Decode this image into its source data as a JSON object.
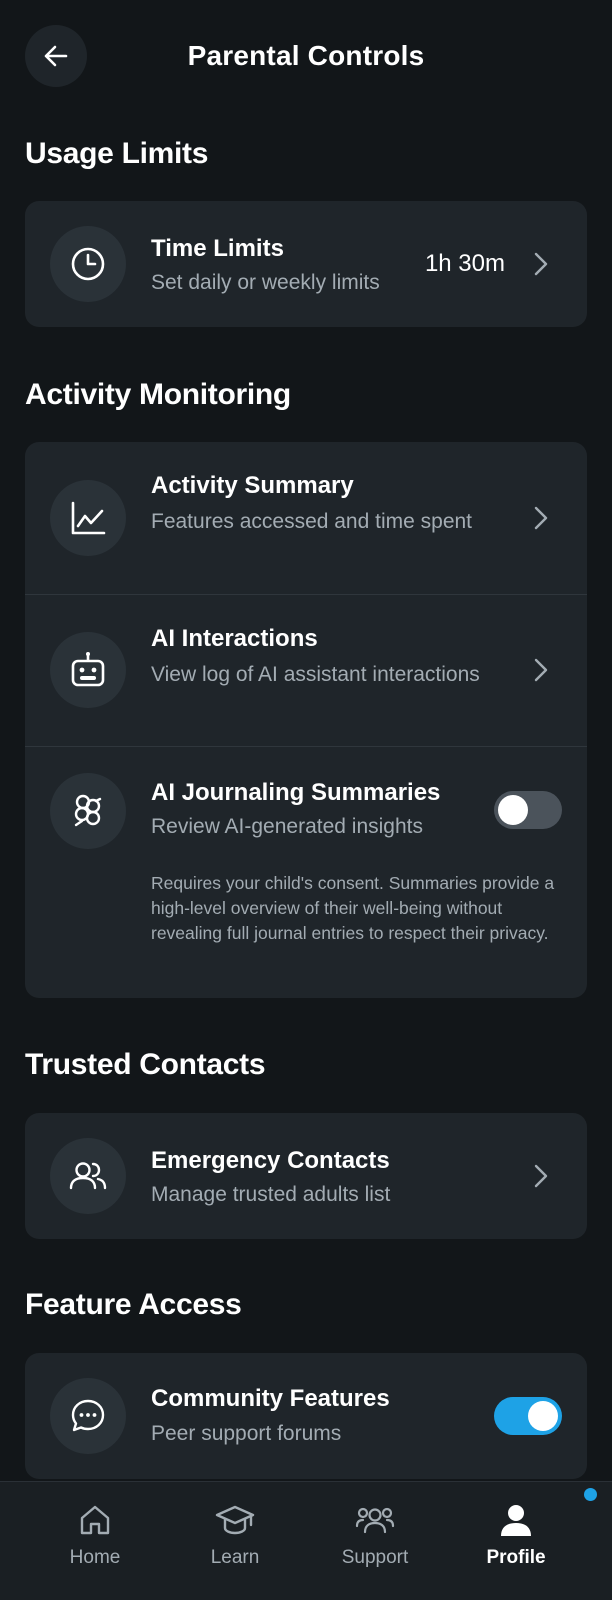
{
  "header": {
    "title": "Parental Controls"
  },
  "sections": {
    "usage": {
      "title": "Usage Limits",
      "time_limits": {
        "title": "Time Limits",
        "subtitle": "Set daily or weekly limits",
        "value": "1h 30m"
      }
    },
    "activity": {
      "title": "Activity Monitoring",
      "summary": {
        "title": "Activity Summary",
        "subtitle": "Features accessed and time spent"
      },
      "ai_interactions": {
        "title": "AI Interactions",
        "subtitle": "View log of AI assistant interactions"
      },
      "ai_journaling": {
        "title": "AI Journaling Summaries",
        "subtitle": "Review AI-generated insights",
        "enabled": false,
        "note": "Requires your child's consent. Summaries provide a high-level overview of their well-being without revealing full journal entries to respect their privacy."
      }
    },
    "trusted": {
      "title": "Trusted Contacts",
      "emergency": {
        "title": "Emergency Contacts",
        "subtitle": "Manage trusted adults list"
      }
    },
    "feature": {
      "title": "Feature Access",
      "community": {
        "title": "Community Features",
        "subtitle": "Peer support forums",
        "enabled": true
      }
    }
  },
  "nav": {
    "items": [
      {
        "label": "Home",
        "icon": "home-icon"
      },
      {
        "label": "Learn",
        "icon": "graduation-cap-icon"
      },
      {
        "label": "Support",
        "icon": "users-icon"
      },
      {
        "label": "Profile",
        "icon": "user-icon",
        "active": true
      }
    ]
  },
  "colors": {
    "background": "#121619",
    "card": "#1f252a",
    "accent": "#1ea2e6",
    "muted_text": "#a3acb3"
  }
}
